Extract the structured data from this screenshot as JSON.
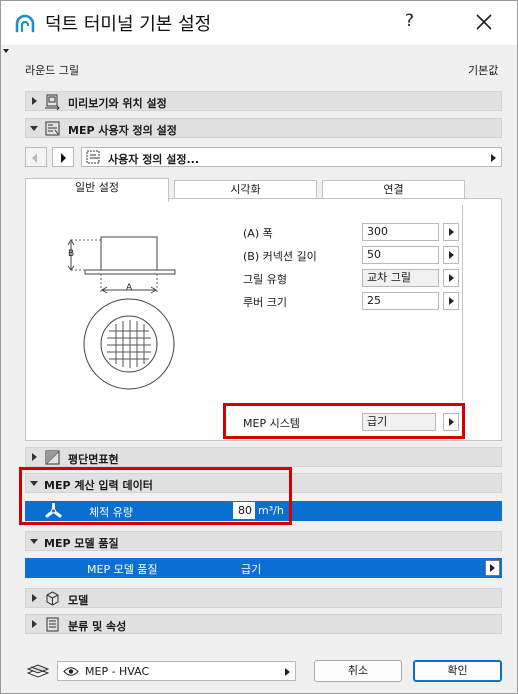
{
  "window": {
    "title": "덕트 터미널 기본 설정",
    "help": "?",
    "icons": [
      "app-logo-icon",
      "close-icon"
    ]
  },
  "header": {
    "left_label": "라운드 그릴",
    "right_label": "기본값"
  },
  "sections": {
    "preview": "미리보기와 위치 설정",
    "mep_custom": "MEP 사용자 정의 설정",
    "floor_plan": "평단면표현",
    "mep_calc": "MEP 계산 입력 데이터",
    "mep_model_quality": "MEP 모델 품질",
    "model": "모델",
    "classification": "분류 및 속성"
  },
  "custom_settings_combo": "사용자 정의 설정...",
  "tabs": [
    "일반 설정",
    "시각화",
    "연결"
  ],
  "diagram": {
    "label_a": "A",
    "label_b": "B"
  },
  "params": [
    {
      "label": "(A) 폭",
      "value": "300"
    },
    {
      "label": "(B) 커넥션 길이",
      "value": "50"
    },
    {
      "label": "그릴 유형",
      "value": "교차 그릴"
    },
    {
      "label": "루버 크기",
      "value": "25"
    }
  ],
  "mep_system": {
    "label": "MEP 시스템",
    "value": "급기"
  },
  "flow": {
    "label": "체적 유량",
    "value": "80",
    "unit": "m³/h"
  },
  "model_quality": {
    "label": "MEP 모델 품질",
    "value": "급기"
  },
  "footer": {
    "layer_combo": "MEP - HVAC",
    "cancel": "취소",
    "ok": "확인"
  },
  "colors": {
    "highlight": "#d40000",
    "selection": "#0a6fd0"
  }
}
